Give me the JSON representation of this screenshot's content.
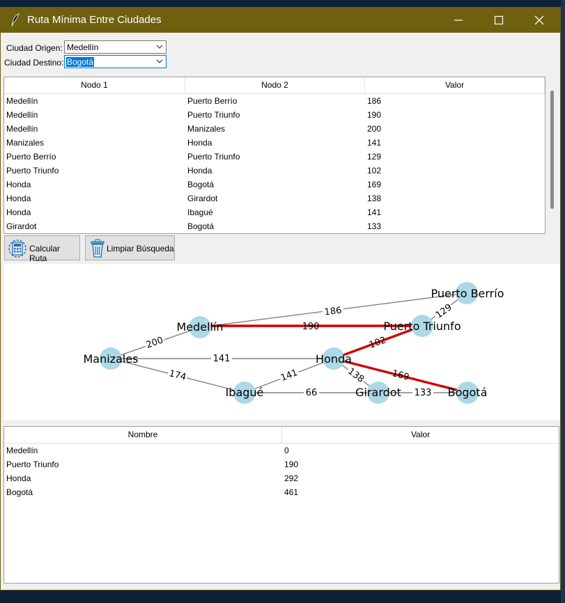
{
  "window": {
    "title": "Ruta Mínima Entre Ciudades",
    "minimize_icon": "minimize-icon",
    "maximize_icon": "maximize-icon",
    "close_icon": "close-icon",
    "title_color": "#6f6010"
  },
  "form": {
    "origin_label": "Ciudad Origen:",
    "origin_value": "Medellín",
    "dest_label": "Ciudad Destino:",
    "dest_value": "Bogotá"
  },
  "edges_table": {
    "headers": [
      "Nodo 1",
      "Nodo 2",
      "Valor"
    ],
    "rows": [
      [
        "Medellín",
        "Puerto Berrío",
        "186"
      ],
      [
        "Medellín",
        "Puerto Triunfo",
        "190"
      ],
      [
        "Medellín",
        "Manizales",
        "200"
      ],
      [
        "Manizales",
        "Honda",
        "141"
      ],
      [
        "Puerto Berrío",
        "Puerto Triunfo",
        "129"
      ],
      [
        "Puerto Triunfo",
        "Honda",
        "102"
      ],
      [
        "Honda",
        "Bogotá",
        "169"
      ],
      [
        "Honda",
        "Girardot",
        "138"
      ],
      [
        "Honda",
        "Ibagué",
        "141"
      ],
      [
        "Girardot",
        "Bogotá",
        "133"
      ]
    ]
  },
  "buttons": {
    "calc_label": "Calcular Ruta",
    "calc_icon": "calculator-icon",
    "clear_label": "Limpiar Búsqueda",
    "clear_icon": "trash-icon"
  },
  "graph": {
    "node_color": "#add8e6",
    "edge_color": "#808080",
    "path_color": "#d00000",
    "nodes": [
      "Puerto Berrío",
      "Medellín",
      "Puerto Triunfo",
      "Manizales",
      "Honda",
      "Ibagué",
      "Girardot",
      "Bogotá"
    ],
    "edge_labels": [
      "186",
      "129",
      "190",
      "200",
      "102",
      "141",
      "141",
      "174",
      "138",
      "169",
      "66",
      "133"
    ]
  },
  "result_table": {
    "headers": [
      "Nombre",
      "Valor"
    ],
    "rows": [
      [
        "Medellín",
        "0"
      ],
      [
        "Puerto Triunfo",
        "190"
      ],
      [
        "Honda",
        "292"
      ],
      [
        "Bogotá",
        "461"
      ]
    ]
  }
}
